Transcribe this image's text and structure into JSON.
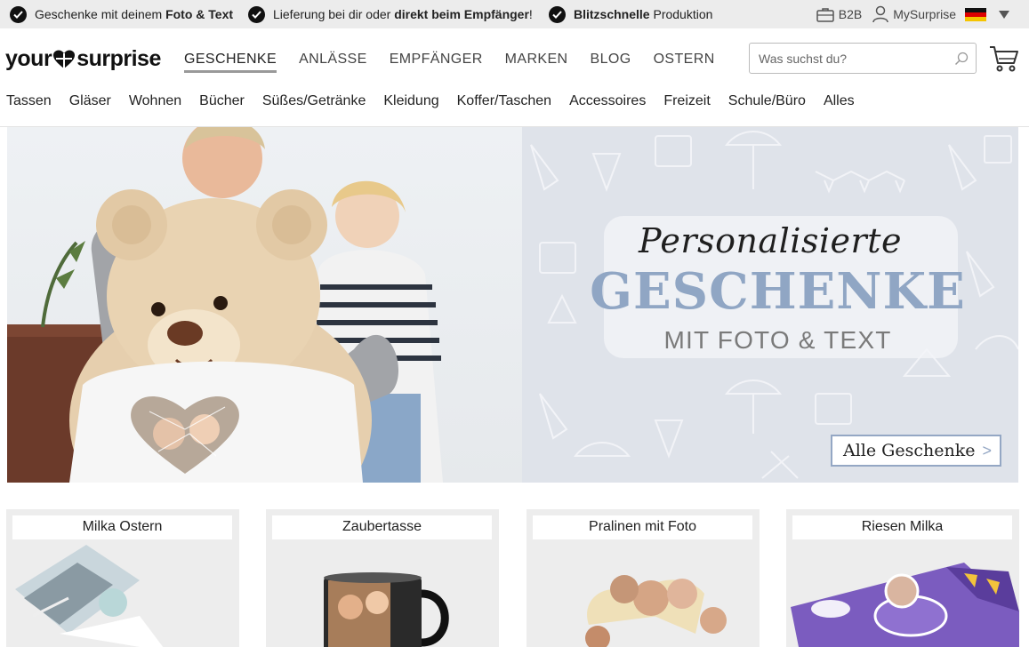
{
  "usp_bar": {
    "items": [
      {
        "pre": "Geschenke mit deinem ",
        "bold": "Foto & Text",
        "post": ""
      },
      {
        "pre": "Lieferung bei dir oder ",
        "bold": "direkt beim Empfänger",
        "post": "!"
      },
      {
        "pre": "",
        "bold": "Blitzschnelle",
        "post": " Produktion"
      }
    ],
    "b2b_label": "B2B",
    "account_label": "MySurprise",
    "country": "Deutschland"
  },
  "header": {
    "logo": {
      "part1": "your",
      "part2": "surprise"
    },
    "main_nav": [
      "GESCHENKE",
      "ANLÄSSE",
      "EMPFÄNGER",
      "MARKEN",
      "BLOG",
      "OSTERN"
    ],
    "active_nav": "GESCHENKE",
    "search_placeholder": "Was suchst du?",
    "sub_nav": [
      "Tassen",
      "Gläser",
      "Wohnen",
      "Bücher",
      "Süßes/Getränke",
      "Kleidung",
      "Koffer/Taschen",
      "Accessoires",
      "Freizeit",
      "Schule/Büro",
      "Alles"
    ]
  },
  "hero": {
    "script": "Personalisierte",
    "title": "GESCHENKE",
    "subtitle": "MIT FOTO & TEXT",
    "button": "Alle Geschenke",
    "button_arrow": ">"
  },
  "tiles": [
    {
      "label": "Milka Ostern"
    },
    {
      "label": "Zaubertasse"
    },
    {
      "label": "Pralinen mit Foto"
    },
    {
      "label": "Riesen Milka"
    }
  ],
  "colors": {
    "accent": "#90a6c4",
    "usp_bg": "#ececec",
    "milka": "#7b5cbf"
  }
}
